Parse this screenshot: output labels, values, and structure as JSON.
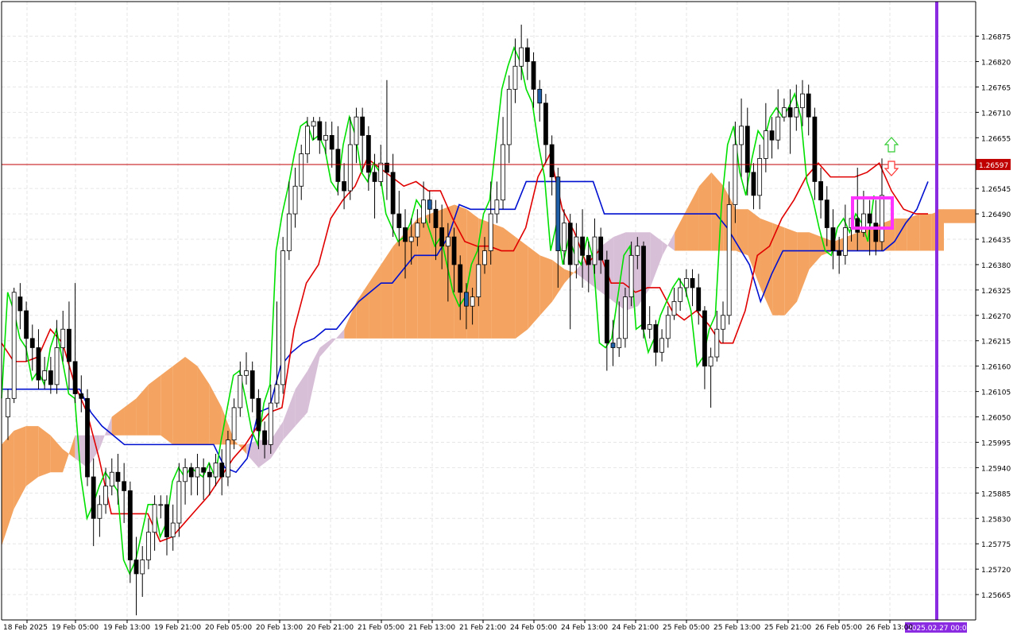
{
  "chart_data": {
    "type": "candlestick",
    "symbol_price_current": "1.26597",
    "y_ticks": [
      "1.26875",
      "1.26820",
      "1.26765",
      "1.26710",
      "1.26655",
      "1.26545",
      "1.26490",
      "1.26435",
      "1.26380",
      "1.26325",
      "1.26270",
      "1.26215",
      "1.26160",
      "1.26105",
      "1.26050",
      "1.25995",
      "1.25940",
      "1.25885",
      "1.25830",
      "1.25775",
      "1.25720",
      "1.25665"
    ],
    "ylim": [
      1.2561,
      1.2695
    ],
    "x_ticks": [
      "18 Feb 2025",
      "19 Feb 05:00",
      "19 Feb 13:00",
      "19 Feb 21:00",
      "20 Feb 05:00",
      "20 Feb 13:00",
      "20 Feb 21:00",
      "21 Feb 05:00",
      "21 Feb 13:00",
      "21 Feb 21:00",
      "24 Feb 05:00",
      "24 Feb 13:00",
      "24 Feb 21:00",
      "25 Feb 05:00",
      "25 Feb 13:00",
      "25 Feb 21:00",
      "26 Feb 05:00",
      "26 Feb 13:00"
    ],
    "cursor_time_label": "2025.02.27 00:00",
    "grid": true,
    "colors": {
      "background": "#ffffff",
      "grid": "#e6e6e6",
      "axis": "#000000",
      "bull_body": "#ffffff",
      "bear_body": "#000000",
      "highlight_bear": "#1f5fa8",
      "tenkan": "#e00000",
      "kijun": "#0010d0",
      "chikou": "#00e000",
      "kumo_bull": "#f4a460",
      "kumo_bear": "#d8bfd8",
      "price_line": "#c00000",
      "price_label_bg": "#c00000",
      "vline": "#8a2be2",
      "marker_box": "#ff33ff",
      "arrow_up": "#33cc33",
      "arrow_down": "#ff3333"
    },
    "price_line_value": 1.26597,
    "candles": [
      [
        1.2605,
        1.2609,
        1.26,
        1.2611
      ],
      [
        1.2609,
        1.2632,
        1.2608,
        1.2633
      ],
      [
        1.2631,
        1.2628,
        1.2624,
        1.2634
      ],
      [
        1.2628,
        1.2622,
        1.2617,
        1.263
      ],
      [
        1.2622,
        1.262,
        1.2615,
        1.2625
      ],
      [
        1.262,
        1.2613,
        1.2611,
        1.2624
      ],
      [
        1.2613,
        1.2615,
        1.2611,
        1.2618
      ],
      [
        1.2615,
        1.2612,
        1.261,
        1.2618
      ],
      [
        1.2612,
        1.262,
        1.261,
        1.2626
      ],
      [
        1.262,
        1.2624,
        1.2617,
        1.2628
      ],
      [
        1.2624,
        1.2617,
        1.2611,
        1.263
      ],
      [
        1.2617,
        1.261,
        1.2608,
        1.2634
      ],
      [
        1.261,
        1.2609,
        1.2606,
        1.2614
      ],
      [
        1.2609,
        1.2592,
        1.259,
        1.2611
      ],
      [
        1.2592,
        1.2583,
        1.2577,
        1.2596
      ],
      [
        1.2583,
        1.2586,
        1.2579,
        1.2588
      ],
      [
        1.2586,
        1.259,
        1.2584,
        1.2594
      ],
      [
        1.259,
        1.2593,
        1.2588,
        1.2596
      ],
      [
        1.2593,
        1.2591,
        1.2586,
        1.2597
      ],
      [
        1.2591,
        1.2589,
        1.2582,
        1.2595
      ],
      [
        1.2589,
        1.2574,
        1.2569,
        1.2591
      ],
      [
        1.2574,
        1.2571,
        1.2562,
        1.2579
      ],
      [
        1.2571,
        1.2574,
        1.2566,
        1.2577
      ],
      [
        1.2574,
        1.258,
        1.2572,
        1.2583
      ],
      [
        1.258,
        1.2586,
        1.2576,
        1.2588
      ],
      [
        1.2586,
        1.2586,
        1.2583,
        1.2588
      ],
      [
        1.2586,
        1.2579,
        1.2575,
        1.2588
      ],
      [
        1.2579,
        1.2582,
        1.2576,
        1.2586
      ],
      [
        1.2582,
        1.2591,
        1.2579,
        1.2595
      ],
      [
        1.2591,
        1.2594,
        1.2586,
        1.2596
      ],
      [
        1.2594,
        1.2592,
        1.2588,
        1.2595
      ],
      [
        1.2592,
        1.2594,
        1.2588,
        1.2597
      ],
      [
        1.2594,
        1.2593,
        1.2587,
        1.2596
      ],
      [
        1.2593,
        1.2592,
        1.2588,
        1.2595
      ],
      [
        1.2592,
        1.2595,
        1.259,
        1.2597
      ],
      [
        1.2595,
        1.2592,
        1.2588,
        1.2598
      ],
      [
        1.2592,
        1.26,
        1.259,
        1.2602
      ],
      [
        1.26,
        1.2607,
        1.2598,
        1.2609
      ],
      [
        1.2607,
        1.2614,
        1.2605,
        1.2617
      ],
      [
        1.2614,
        1.2615,
        1.2612,
        1.2619
      ],
      [
        1.2615,
        1.2609,
        1.2606,
        1.2617
      ],
      [
        1.2609,
        1.2602,
        1.2598,
        1.2611
      ],
      [
        1.2602,
        1.2599,
        1.2596,
        1.2604
      ],
      [
        1.2599,
        1.2608,
        1.2597,
        1.2612
      ],
      [
        1.2608,
        1.2612,
        1.2607,
        1.263
      ],
      [
        1.2612,
        1.2641,
        1.261,
        1.2644
      ],
      [
        1.2641,
        1.2649,
        1.2639,
        1.2656
      ],
      [
        1.2649,
        1.2655,
        1.2646,
        1.2659
      ],
      [
        1.2655,
        1.2662,
        1.2652,
        1.2664
      ],
      [
        1.2662,
        1.2668,
        1.266,
        1.267
      ],
      [
        1.2668,
        1.2669,
        1.2665,
        1.267
      ],
      [
        1.2669,
        1.2665,
        1.2662,
        1.267
      ],
      [
        1.2665,
        1.2666,
        1.2662,
        1.2669
      ],
      [
        1.2666,
        1.2663,
        1.2659,
        1.2669
      ],
      [
        1.2663,
        1.2656,
        1.2653,
        1.2668
      ],
      [
        1.2656,
        1.2654,
        1.265,
        1.266
      ],
      [
        1.2654,
        1.2664,
        1.2652,
        1.267
      ],
      [
        1.2664,
        1.267,
        1.266,
        1.2672
      ],
      [
        1.267,
        1.2666,
        1.2658,
        1.2672
      ],
      [
        1.2666,
        1.2658,
        1.2654,
        1.2668
      ],
      [
        1.2658,
        1.2656,
        1.2648,
        1.2662
      ],
      [
        1.2656,
        1.266,
        1.2655,
        1.2664
      ],
      [
        1.266,
        1.2658,
        1.2652,
        1.2678
      ],
      [
        1.2658,
        1.2649,
        1.2644,
        1.2662
      ],
      [
        1.2649,
        1.2646,
        1.2642,
        1.2654
      ],
      [
        1.2646,
        1.2643,
        1.2635,
        1.265
      ],
      [
        1.2643,
        1.2644,
        1.2638,
        1.2648
      ],
      [
        1.2644,
        1.2647,
        1.2642,
        1.265
      ],
      [
        1.2647,
        1.2652,
        1.2646,
        1.2656
      ],
      [
        1.2652,
        1.265,
        1.2647,
        1.2654
      ],
      [
        1.265,
        1.2646,
        1.2639,
        1.2652
      ],
      [
        1.2646,
        1.2642,
        1.2637,
        1.2651
      ],
      [
        1.2642,
        1.2644,
        1.263,
        1.2647
      ],
      [
        1.2644,
        1.2638,
        1.2632,
        1.2646
      ],
      [
        1.2638,
        1.2632,
        1.2626,
        1.264
      ],
      [
        1.2632,
        1.2629,
        1.2624,
        1.2634
      ],
      [
        1.2629,
        1.2631,
        1.2625,
        1.2633
      ],
      [
        1.2631,
        1.2638,
        1.2629,
        1.2642
      ],
      [
        1.2638,
        1.2641,
        1.2636,
        1.2644
      ],
      [
        1.2641,
        1.2649,
        1.2638,
        1.2656
      ],
      [
        1.2649,
        1.2652,
        1.2647,
        1.2656
      ],
      [
        1.2652,
        1.2664,
        1.265,
        1.267
      ],
      [
        1.2664,
        1.2676,
        1.266,
        1.2679
      ],
      [
        1.2676,
        1.2681,
        1.2673,
        1.2687
      ],
      [
        1.2681,
        1.2685,
        1.2678,
        1.269
      ],
      [
        1.2685,
        1.2682,
        1.2678,
        1.2687
      ],
      [
        1.2682,
        1.2676,
        1.2672,
        1.2684
      ],
      [
        1.2676,
        1.2673,
        1.2669,
        1.2678
      ],
      [
        1.2673,
        1.2664,
        1.266,
        1.2675
      ],
      [
        1.2664,
        1.2657,
        1.2653,
        1.2666
      ],
      [
        1.2657,
        1.2641,
        1.2633,
        1.2659
      ],
      [
        1.2641,
        1.2647,
        1.2638,
        1.265
      ],
      [
        1.2647,
        1.2638,
        1.2624,
        1.2649
      ],
      [
        1.2638,
        1.2644,
        1.2635,
        1.2647
      ],
      [
        1.2644,
        1.264,
        1.2633,
        1.265
      ],
      [
        1.264,
        1.2638,
        1.2632,
        1.2643
      ],
      [
        1.2638,
        1.2644,
        1.2636,
        1.2648
      ],
      [
        1.2644,
        1.2639,
        1.2636,
        1.2646
      ],
      [
        1.2639,
        1.2621,
        1.2615,
        1.2641
      ],
      [
        1.2621,
        1.262,
        1.2616,
        1.2626
      ],
      [
        1.262,
        1.2622,
        1.2618,
        1.263
      ],
      [
        1.2622,
        1.2631,
        1.262,
        1.2633
      ],
      [
        1.2631,
        1.264,
        1.2629,
        1.2643
      ],
      [
        1.264,
        1.2642,
        1.2637,
        1.2644
      ],
      [
        1.2642,
        1.2624,
        1.2622,
        1.2643
      ],
      [
        1.2624,
        1.2625,
        1.2622,
        1.2629
      ],
      [
        1.2625,
        1.2619,
        1.2616,
        1.2626
      ],
      [
        1.2619,
        1.2622,
        1.2617,
        1.2624
      ],
      [
        1.2622,
        1.2627,
        1.262,
        1.2629
      ],
      [
        1.2627,
        1.263,
        1.2626,
        1.2633
      ],
      [
        1.263,
        1.2633,
        1.2628,
        1.2635
      ],
      [
        1.2633,
        1.2635,
        1.2631,
        1.2637
      ],
      [
        1.2635,
        1.2633,
        1.2629,
        1.2637
      ],
      [
        1.2633,
        1.2628,
        1.2625,
        1.2636
      ],
      [
        1.2628,
        1.2616,
        1.2611,
        1.2629
      ],
      [
        1.2616,
        1.2618,
        1.2607,
        1.262
      ],
      [
        1.2618,
        1.2624,
        1.2617,
        1.2628
      ],
      [
        1.2624,
        1.2627,
        1.2621,
        1.263
      ],
      [
        1.2627,
        1.2651,
        1.2625,
        1.2656
      ],
      [
        1.2651,
        1.2664,
        1.2647,
        1.2669
      ],
      [
        1.2664,
        1.2668,
        1.2657,
        1.2674
      ],
      [
        1.2668,
        1.2658,
        1.2653,
        1.2672
      ],
      [
        1.2658,
        1.2653,
        1.265,
        1.266
      ],
      [
        1.2653,
        1.2661,
        1.265,
        1.2664
      ],
      [
        1.2661,
        1.2667,
        1.2658,
        1.2673
      ],
      [
        1.2667,
        1.2665,
        1.2661,
        1.267
      ],
      [
        1.2665,
        1.267,
        1.2663,
        1.2676
      ],
      [
        1.267,
        1.2672,
        1.2669,
        1.2674
      ],
      [
        1.2672,
        1.267,
        1.2662,
        1.2676
      ],
      [
        1.267,
        1.2672,
        1.2667,
        1.2677
      ],
      [
        1.2672,
        1.2675,
        1.2668,
        1.2678
      ],
      [
        1.2675,
        1.267,
        1.2666,
        1.2677
      ],
      [
        1.267,
        1.2656,
        1.2652,
        1.2672
      ],
      [
        1.2656,
        1.2652,
        1.2648,
        1.2659
      ],
      [
        1.2652,
        1.2646,
        1.2642,
        1.2655
      ],
      [
        1.2646,
        1.2641,
        1.2637,
        1.265
      ],
      [
        1.2641,
        1.264,
        1.2636,
        1.2644
      ],
      [
        1.264,
        1.2646,
        1.2638,
        1.2651
      ],
      [
        1.2646,
        1.2648,
        1.2643,
        1.2651
      ],
      [
        1.2648,
        1.2645,
        1.2641,
        1.2659
      ],
      [
        1.2645,
        1.2649,
        1.2644,
        1.2654
      ],
      [
        1.2649,
        1.2647,
        1.264,
        1.2652
      ],
      [
        1.2647,
        1.2643,
        1.264,
        1.2652
      ],
      [
        1.2643,
        1.2653,
        1.2641,
        1.2661
      ]
    ],
    "highlighted_candles": [
      64,
      65,
      66,
      67,
      68,
      69,
      70,
      71,
      72,
      73,
      74,
      75,
      76,
      77,
      78,
      79,
      80,
      81,
      82,
      83,
      84,
      85,
      86,
      87,
      88,
      89,
      90,
      91,
      92,
      93,
      94,
      95,
      96,
      97,
      98,
      99
    ],
    "tenkan": [
      1.2621,
      1.2617,
      1.2617,
      1.2618,
      1.2624,
      1.2621,
      1.2612,
      1.2606,
      1.2596,
      1.2584,
      1.2584,
      1.2584,
      1.2584,
      1.2578,
      1.2579,
      1.2582,
      1.2585,
      1.2588,
      1.2592,
      1.2596,
      1.2599,
      1.2603,
      1.2606,
      1.2607,
      1.2624,
      1.2634,
      1.2638,
      1.2648,
      1.2652,
      1.2655,
      1.2661,
      1.2659,
      1.2657,
      1.2655,
      1.2656,
      1.2654,
      1.2654,
      1.2648,
      1.2643,
      1.2642,
      1.2642,
      1.2641,
      1.2641,
      1.2646,
      1.2657,
      1.2662,
      1.265,
      1.2645,
      1.2638,
      1.2641,
      1.2634,
      1.2634,
      1.2632,
      1.2633,
      1.2633,
      1.2628,
      1.2626,
      1.2628,
      1.2625,
      1.2621,
      1.2621,
      1.2628,
      1.264,
      1.2642,
      1.2648,
      1.2652,
      1.2657,
      1.266,
      1.2657,
      1.2657,
      1.2657,
      1.2658,
      1.266,
      1.2654,
      1.265,
      1.2649,
      1.2649
    ],
    "kijun": [
      1.2611,
      1.2611,
      1.2611,
      1.2611,
      1.2611,
      1.2611,
      1.2611,
      1.2611,
      1.2606,
      1.2603,
      1.2601,
      1.2599,
      1.2599,
      1.2599,
      1.2599,
      1.2599,
      1.2599,
      1.2599,
      1.2599,
      1.2599,
      1.2594,
      1.2593,
      1.2596,
      1.2606,
      1.2607,
      1.2616,
      1.2619,
      1.2621,
      1.2622,
      1.2624,
      1.2624,
      1.2627,
      1.263,
      1.2632,
      1.2634,
      1.2634,
      1.2637,
      1.264,
      1.264,
      1.264,
      1.2644,
      1.2651,
      1.265,
      1.265,
      1.265,
      1.265,
      1.265,
      1.2656,
      1.2656,
      1.2656,
      1.2656,
      1.2656,
      1.2656,
      1.2656,
      1.2649,
      1.2649,
      1.2649,
      1.2649,
      1.2649,
      1.2649,
      1.2649,
      1.2649,
      1.2649,
      1.2649,
      1.2649,
      1.2646,
      1.2642,
      1.2638,
      1.263,
      1.2636,
      1.2641,
      1.2641,
      1.2641,
      1.2641,
      1.2641,
      1.2641,
      1.2641,
      1.2641,
      1.2641,
      1.2641,
      1.2643,
      1.2647,
      1.265,
      1.2656
    ]
  }
}
